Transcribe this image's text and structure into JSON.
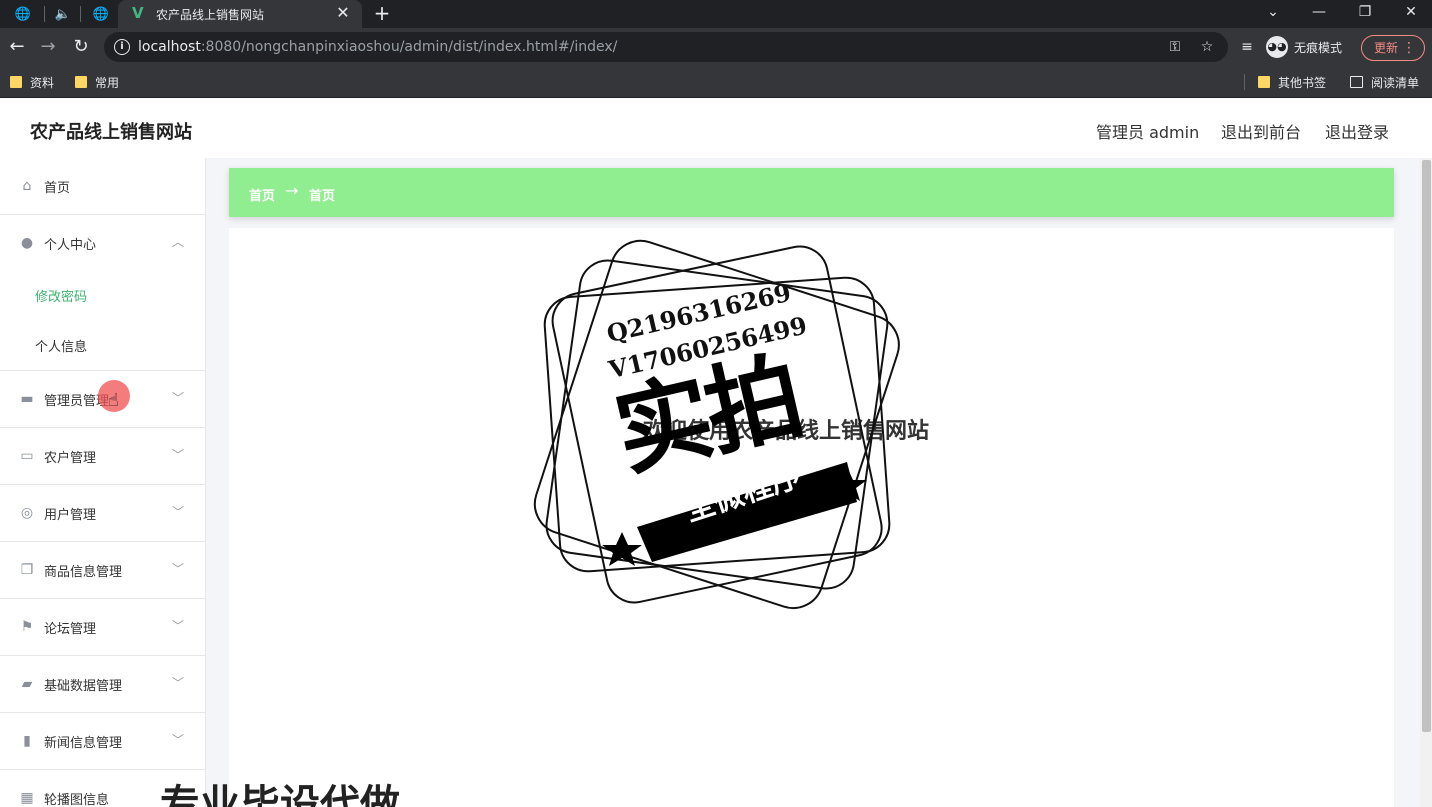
{
  "browser": {
    "tab_title": "农产品线上销售网站",
    "url_host": "localhost",
    "url_rest": ":8080/nongchanpinxiaoshou/admin/dist/index.html#/index/",
    "incognito_label": "无痕模式",
    "update_label": "更新",
    "bookmarks": [
      "资料",
      "常用"
    ],
    "other_bookmarks": "其他书签",
    "reading_list": "阅读清单"
  },
  "header": {
    "site_title": "农产品线上销售网站",
    "user_label": "管理员 admin",
    "back_to_front": "退出到前台",
    "logout": "退出登录"
  },
  "sidebar": {
    "items": [
      {
        "label": "首页",
        "icon": "home-icon"
      },
      {
        "label": "个人中心",
        "icon": "user-icon",
        "expanded": true,
        "children": [
          {
            "label": "修改密码",
            "active": true
          },
          {
            "label": "个人信息"
          }
        ]
      },
      {
        "label": "管理员管理",
        "icon": "admin-icon"
      },
      {
        "label": "农户管理",
        "icon": "chat-icon"
      },
      {
        "label": "用户管理",
        "icon": "compass-icon"
      },
      {
        "label": "商品信息管理",
        "icon": "copy-icon"
      },
      {
        "label": "论坛管理",
        "icon": "flag-icon"
      },
      {
        "label": "基础数据管理",
        "icon": "briefcase-icon"
      },
      {
        "label": "新闻信息管理",
        "icon": "bar-chart-icon"
      },
      {
        "label": "轮播图信息",
        "icon": "grid-icon"
      }
    ]
  },
  "breadcrumb": {
    "first": "首页",
    "separator": "→",
    "second": "首页"
  },
  "main": {
    "welcome": "欢迎使用农产品线上销售网站"
  },
  "watermark": {
    "contact_q": "Q2196316269",
    "contact_v": "V17060256499",
    "big_text": "实拍",
    "banner_text": "全微程序",
    "bottom_text": "专业毕设代做"
  },
  "colors": {
    "breadcrumb_bg": "#90ee90",
    "active_menu": "#3cb371"
  }
}
